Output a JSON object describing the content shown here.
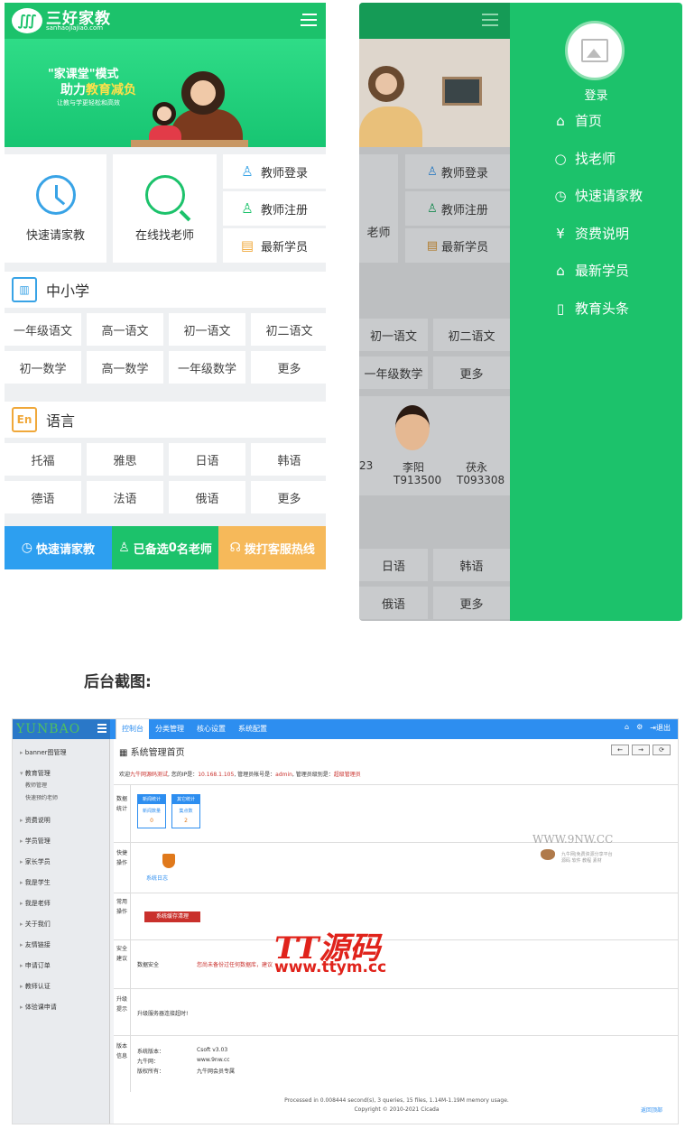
{
  "phone1": {
    "brand": "三好家教",
    "brand_sub": "sanhaojiajiao.com",
    "banner": {
      "line1": "\"家课堂\"模式",
      "line2_a": "助力",
      "line2_b": "教育减负",
      "line3": "让教与学更轻松和高效"
    },
    "quick": [
      {
        "label": "快速请家教"
      },
      {
        "label": "在线找老师"
      }
    ],
    "side_buttons": [
      {
        "label": "教师登录",
        "icon": "user-icon"
      },
      {
        "label": "教师注册",
        "icon": "user-add-icon"
      },
      {
        "label": "最新学员",
        "icon": "list-icon"
      }
    ],
    "section1": {
      "title": "中小学",
      "cells": [
        "一年级语文",
        "高一语文",
        "初一语文",
        "初二语文",
        "初一数学",
        "高一数学",
        "一年级数学",
        "更多"
      ]
    },
    "section2": {
      "title": "语言",
      "icon_text": "En",
      "cells": [
        "托福",
        "雅思",
        "日语",
        "韩语",
        "德语",
        "法语",
        "俄语",
        "更多"
      ]
    },
    "footer": [
      {
        "label": "快速请家教",
        "color": "#2d9ff0"
      },
      {
        "label_a": "已备选",
        "label_b": "0",
        "label_c": "名老师",
        "color": "#1cc26b"
      },
      {
        "label": "拨打客服热线",
        "color": "#f6b95a"
      }
    ]
  },
  "phone2": {
    "side_buttons": [
      "教师登录",
      "教师注册",
      "最新学员"
    ],
    "partial_quick": "老师",
    "grid_cells": [
      "初一语文",
      "初二语文",
      "一年级数学",
      "更多"
    ],
    "teachers": [
      {
        "name": "李阳",
        "id": "T913500"
      },
      {
        "name": "茯永",
        "id": "T093308"
      }
    ],
    "partial_teacher_id": "23",
    "lang_cells": [
      "日语",
      "韩语",
      "俄语",
      "更多"
    ],
    "drawer": {
      "login": "登录",
      "items": [
        {
          "label": "首页",
          "icon": "home-icon"
        },
        {
          "label": "找老师",
          "icon": "search-icon"
        },
        {
          "label": "快速请家教",
          "icon": "clock-icon"
        },
        {
          "label": "资费说明",
          "icon": "yen-icon"
        },
        {
          "label": "最新学员",
          "icon": "graduation-icon"
        },
        {
          "label": "教育头条",
          "icon": "book-icon"
        }
      ]
    }
  },
  "caption": "后台截图:",
  "admin": {
    "logo": "YUNBAO",
    "tabs": [
      "控制台",
      "分类管理",
      "核心设置",
      "系统配置"
    ],
    "top_right": "退出",
    "sidebar": [
      "banner图管理",
      "教育管理",
      "资费说明",
      "学员管理",
      "家长学员",
      "我是学生",
      "我是老师",
      "关于我们",
      "友情链接",
      "申请订单",
      "教师认证",
      "体验课申请"
    ],
    "sidebar_sub": [
      "教师管理",
      "快速预约老师"
    ],
    "title": "系统管理首页",
    "nav_buttons": [
      "←",
      "→",
      "⟳"
    ],
    "welcome_a": "欢迎",
    "welcome_b": "九牛网源码测试",
    "welcome_c": ", 您的IP是：",
    "welcome_ip": "10.168.1.105",
    "welcome_d": ", 管理员帐号是：",
    "welcome_admin": "admin",
    "welcome_e": ", 管理员级别是：",
    "welcome_level": "超级管理员",
    "rows": {
      "stats_label": "数据统计",
      "stats": [
        {
          "head": "新闻统计",
          "title": "新闻数量",
          "num": "0"
        },
        {
          "head": "其它统计",
          "title": "集点数",
          "num": "2"
        }
      ],
      "quick_label": "快捷操作",
      "quick_item": "系统日志",
      "common_label": "常用操作",
      "common_btn": "系统缓存清理",
      "security_label": "安全建议",
      "security_key": "数据安全",
      "security_val": "您尚未备份过任何数据库，建议",
      "upgrade_label": "升级提示",
      "upgrade_val": "升级服务器连接超时!",
      "version_label": "版本信息",
      "version": [
        {
          "k": "系统版本：",
          "v": "Csoft v3.03"
        },
        {
          "k": "九牛网：",
          "v": "www.9nw.cc"
        },
        {
          "k": "版权所有：",
          "v": "九牛网会员专属"
        }
      ]
    },
    "footer1": "Processed in 0.008444 second(s), 3 queries, 15 files, 1.14M-1.19M memory usage.",
    "footer2": "Copyright © 2010-2021 Cicada",
    "footer_link": "返回顶部",
    "wm_top": "WWW.9NW.CC",
    "wm_top_sub": "九牛网|免费资源分享平台",
    "wm_top_sub2": "源码 软件 教程 素材",
    "wm_main": "TT源码",
    "wm_url": "www.ttym.cc"
  }
}
